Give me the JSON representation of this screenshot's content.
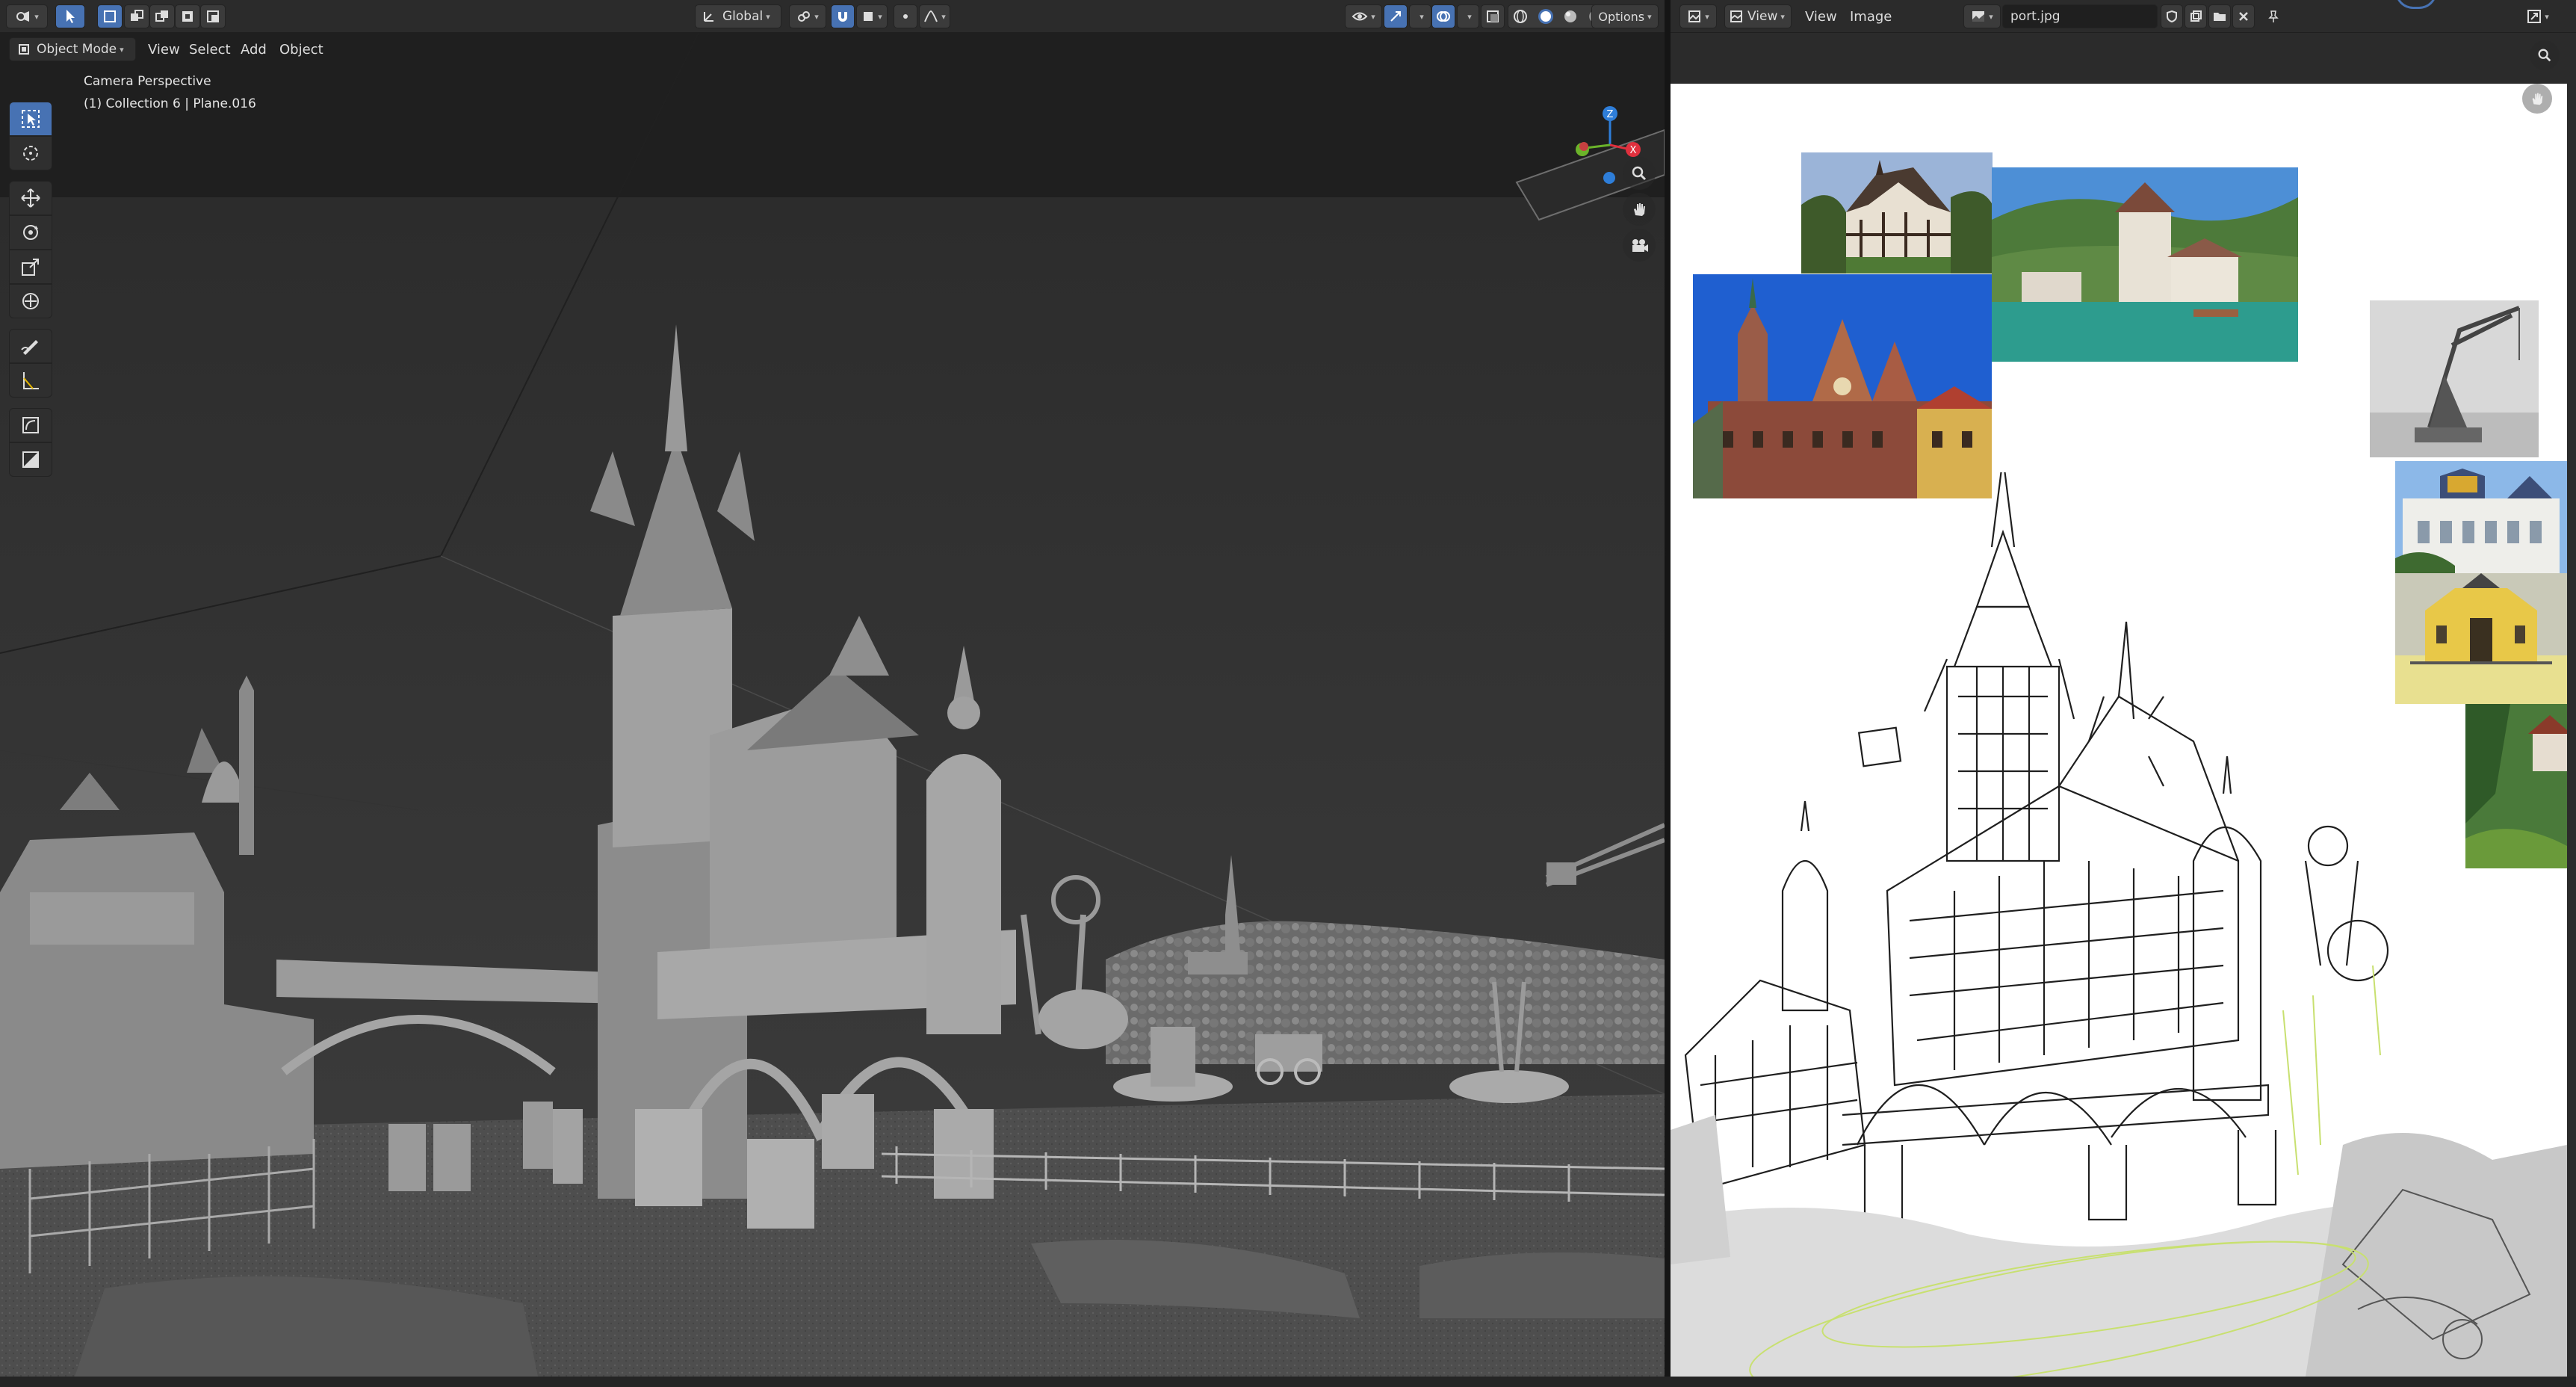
{
  "viewport": {
    "header": {
      "mode_label": "Object Mode",
      "menus": [
        "View",
        "Select",
        "Add",
        "Object"
      ],
      "orientation_label": "Global",
      "options_label": "Options"
    },
    "overlay": {
      "line1": "Camera Perspective",
      "line2": "(1) Collection 6 | Plane.016"
    },
    "gizmo_axes": [
      "Z",
      "X"
    ],
    "tools": [
      {
        "name": "select-box-icon",
        "active": true
      },
      {
        "name": "cursor-icon",
        "active": false
      },
      {
        "name": "move-icon",
        "active": false
      },
      {
        "name": "rotate-icon",
        "active": false
      },
      {
        "name": "scale-icon",
        "active": false
      },
      {
        "name": "transform-icon",
        "active": false
      },
      {
        "name": "annotate-icon",
        "active": false
      },
      {
        "name": "measure-icon",
        "active": false
      },
      {
        "name": "add-cube-icon",
        "active": false
      },
      {
        "name": "add-plane-icon",
        "active": false
      }
    ]
  },
  "image_editor": {
    "header": {
      "menus": [
        "View",
        "View",
        "Image"
      ],
      "image_name": "port.jpg"
    }
  },
  "colors": {
    "accent": "#4772b3",
    "header_bg": "#2b2b2b",
    "viewport_bg": "#3a3a3a",
    "axis_x": "#e0303e",
    "axis_y": "#6bb32a",
    "axis_z": "#2e7ed9"
  }
}
